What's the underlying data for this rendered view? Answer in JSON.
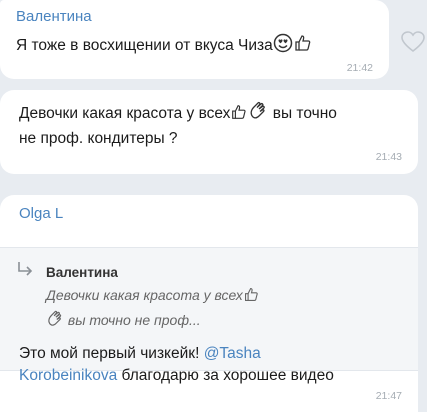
{
  "messages": [
    {
      "sender": "Валентина",
      "text": "Я тоже в восхищении от вкуса Чиза",
      "time": "21:42",
      "emoji": [
        "heart-eyes-emoji",
        "thumbs-up-emoji"
      ]
    },
    {
      "line1": "Девочки какая красота у всех",
      "line1_after": " вы точно",
      "line2": "не  проф. кондитеры ?",
      "time": "21:43",
      "emoji": [
        "thumbs-up-emoji",
        "clapping-hands-emoji"
      ]
    },
    {
      "sender": "Olga L",
      "quote": {
        "author": "Валентина",
        "line1": "Девочки какая красота у всех",
        "line2": " вы точно не  проф..."
      },
      "text_before": "Это мой первый чизкейк! ",
      "mention": "@Tasha",
      "mention_cont": "Korobeinikova",
      "text_after": " благодарю за хорошее видео",
      "time": "21:47"
    }
  ],
  "icons": {
    "like": "heart-outline-icon",
    "reply": "reply-arrow-icon"
  },
  "colors": {
    "sender": "#4a84bf",
    "background": "#e8ecf1",
    "bubble": "#ffffff",
    "time": "#a5acb3"
  }
}
